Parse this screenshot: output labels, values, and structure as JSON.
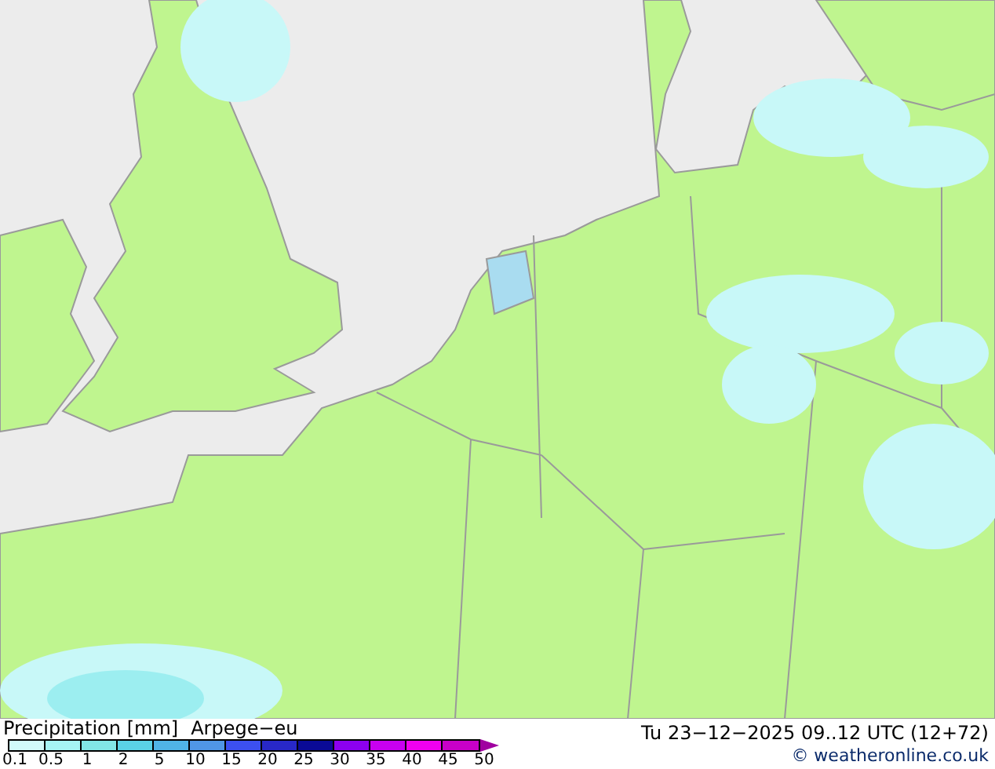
{
  "legend": {
    "title": "Precipitation [mm]",
    "model": "Arpege−eu",
    "scale": [
      {
        "color": "#d2fafa"
      },
      {
        "color": "#a6f5f5"
      },
      {
        "color": "#82e6e6"
      },
      {
        "color": "#5ad2e6"
      },
      {
        "color": "#50b4e6"
      },
      {
        "color": "#5096e6"
      },
      {
        "color": "#3c50f0"
      },
      {
        "color": "#2828c8"
      },
      {
        "color": "#0a0a96"
      },
      {
        "color": "#8c00f0"
      },
      {
        "color": "#c800f0"
      },
      {
        "color": "#f000f0"
      },
      {
        "color": "#c800c8"
      }
    ],
    "overflow": {
      "color": "#a000a0"
    },
    "labels": [
      "0.1",
      "0.5",
      "1",
      "2",
      "5",
      "10",
      "15",
      "20",
      "25",
      "30",
      "35",
      "40",
      "45",
      "50"
    ]
  },
  "valid_time": "Tu 23−12−2025 09..12 UTC (12+72)",
  "copyright": "© weatheronline.co.uk"
}
